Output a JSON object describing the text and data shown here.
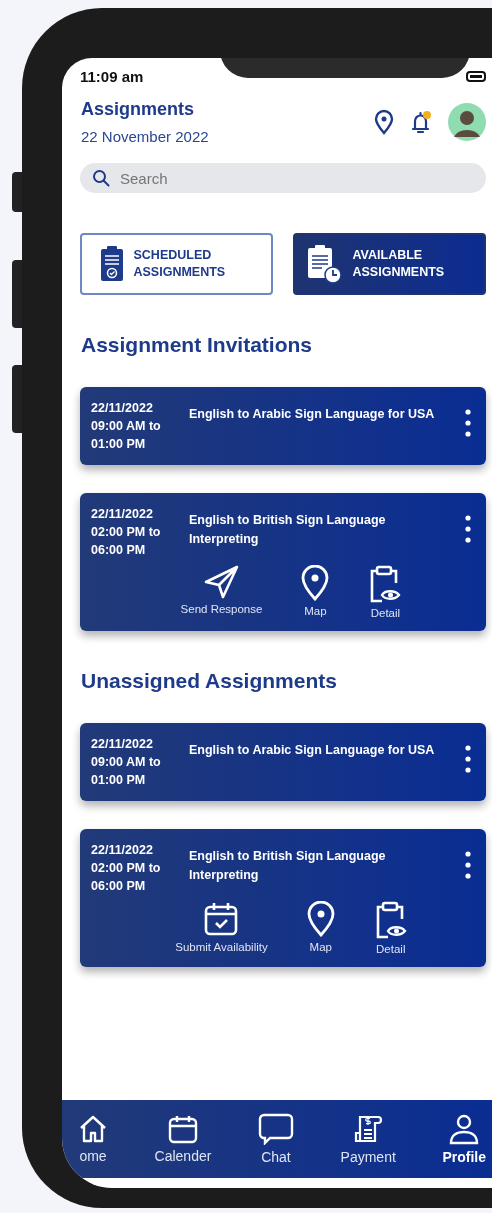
{
  "status_bar": {
    "time": "11:09 am"
  },
  "header": {
    "title": "Assignments",
    "date": "22 November 2022",
    "notification": true
  },
  "search": {
    "placeholder": "Search"
  },
  "tabs": [
    {
      "label": "SCHEDULED ASSIGNMENTS",
      "kind": "scheduled",
      "selected": false
    },
    {
      "label": "AVAILABLE ASSIGNMENTS",
      "kind": "available",
      "selected": true
    }
  ],
  "sections": [
    {
      "title": "Assignment Invitations",
      "cards": [
        {
          "date": "22/11/2022",
          "time_from": "09:00 AM to",
          "time_to": "01:00 PM",
          "title": "English to Arabic Sign Language for USA"
        },
        {
          "date": "22/11/2022",
          "time_from": "02:00 PM to",
          "time_to": "06:00 PM",
          "title": "English to British Sign Language Interpreting",
          "actions": [
            {
              "kind": "send",
              "label": "Send Response"
            },
            {
              "kind": "map",
              "label": "Map"
            },
            {
              "kind": "detail",
              "label": "Detail"
            }
          ]
        }
      ]
    },
    {
      "title": "Unassigned Assignments",
      "cards": [
        {
          "date": "22/11/2022",
          "time_from": "09:00 AM to",
          "time_to": "01:00 PM",
          "title": "English to Arabic Sign Language for USA"
        },
        {
          "date": "22/11/2022",
          "time_from": "02:00 PM to",
          "time_to": "06:00 PM",
          "title": "English to British Sign Language Interpreting",
          "actions": [
            {
              "kind": "availability",
              "label": "Submit Availability"
            },
            {
              "kind": "map",
              "label": "Map"
            },
            {
              "kind": "detail",
              "label": "Detail"
            }
          ]
        }
      ]
    }
  ],
  "nav": [
    {
      "kind": "home",
      "label": "ome",
      "selected": false
    },
    {
      "kind": "calendar",
      "label": "Calender",
      "selected": false
    },
    {
      "kind": "chat",
      "label": "Chat",
      "selected": false
    },
    {
      "kind": "payment",
      "label": "Payment",
      "selected": false
    },
    {
      "kind": "profile",
      "label": "Profile",
      "selected": true
    }
  ]
}
